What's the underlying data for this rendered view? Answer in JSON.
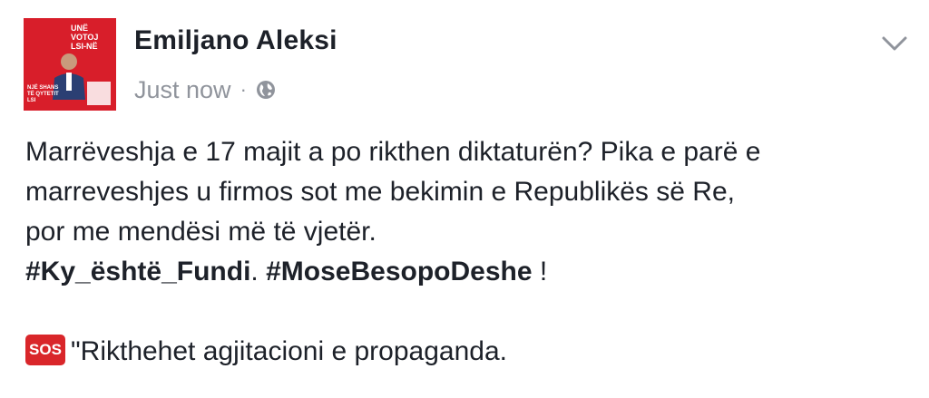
{
  "post": {
    "author": "Emiljano Aleksi",
    "timestamp": "Just now",
    "separator": "·",
    "privacy_icon": "globe-icon",
    "menu_icon": "chevron-down-icon",
    "avatar": {
      "top_text": "UNË VOTOJ LSI-NË",
      "bottom_text": "NJË SHANS TË QYTETIT LSI"
    },
    "lines": [
      "Marrëveshja e 17 majit a po rikthen diktaturën? Pika e parë e",
      "marreveshjes u firmos sot me bekimin e Republikës së Re,",
      "por me mendësi më të vjetër."
    ],
    "hashtag_1": "#Ky_është_Fundi",
    "hashtag_sep": ".  ",
    "hashtag_2": "#MoseBesopoDeshe",
    "hashtag_end": " !",
    "sos_label": "SOS",
    "last_line": "\"Rikthehet agjitacioni e propaganda."
  },
  "colors": {
    "text": "#1d2129",
    "meta": "#90949c",
    "sos_red": "#d9262a",
    "avatar_red": "#d81e2a"
  }
}
